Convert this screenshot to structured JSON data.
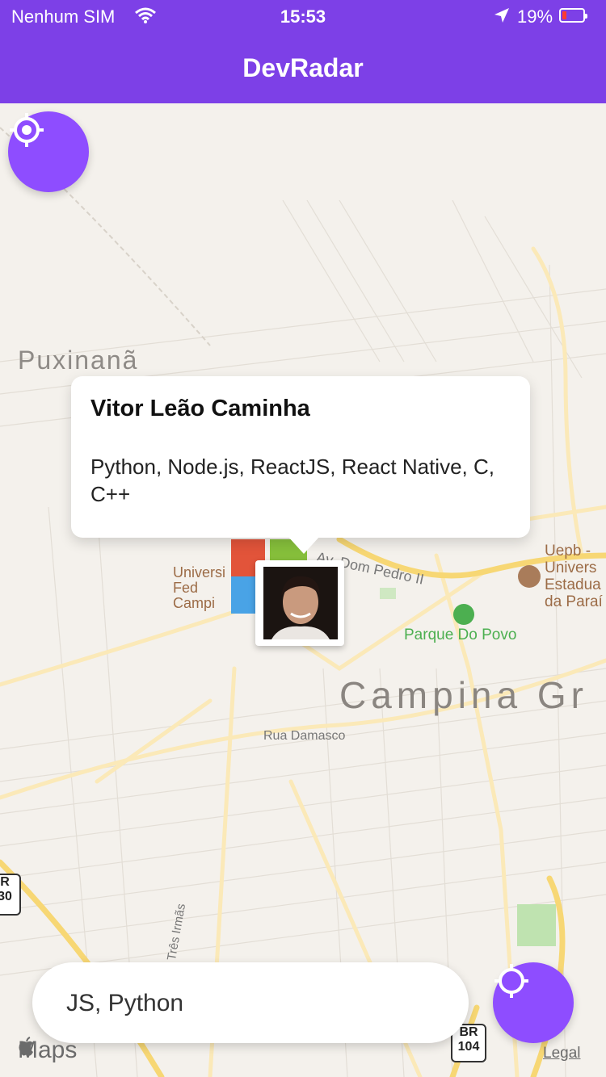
{
  "status_bar": {
    "carrier": "Nenhum SIM",
    "time": "15:53",
    "battery_percent": "19%",
    "battery_level": 0.19
  },
  "nav": {
    "title": "DevRadar"
  },
  "map": {
    "labels": {
      "puxinana": "Puxinanã",
      "campina": "Campina Gr",
      "parque": "Parque Do Povo",
      "uepb": [
        "Uepb -",
        "Univers",
        "Estadua",
        "da Paraí"
      ],
      "university": [
        "Universi",
        "Fed",
        "Campi"
      ],
      "dom_pedro": "Av. Dom Pedro II",
      "damasco": "Rua Damasco",
      "tres_irmas": "Três Irmãs"
    },
    "shields": {
      "br104_top": "BR",
      "br104_bottom": "104",
      "left_top": "R",
      "left_bottom": "30"
    },
    "attribution": "Maps",
    "legal": "Legal"
  },
  "callout": {
    "name": "Vitor Leão Caminha",
    "techs": "Python, Node.js, ReactJS, React Native, C, C++"
  },
  "search": {
    "value": "JS, Python"
  },
  "icons": {
    "top_button": "crosshair-icon",
    "bottom_button": "crosshair-icon",
    "status_wifi": "wifi-icon",
    "status_location": "location-arrow-icon"
  },
  "colors": {
    "accent": "#7d40e7",
    "fab": "#8e4dff",
    "road_major": "#f7d774",
    "park": "#4caf50"
  }
}
